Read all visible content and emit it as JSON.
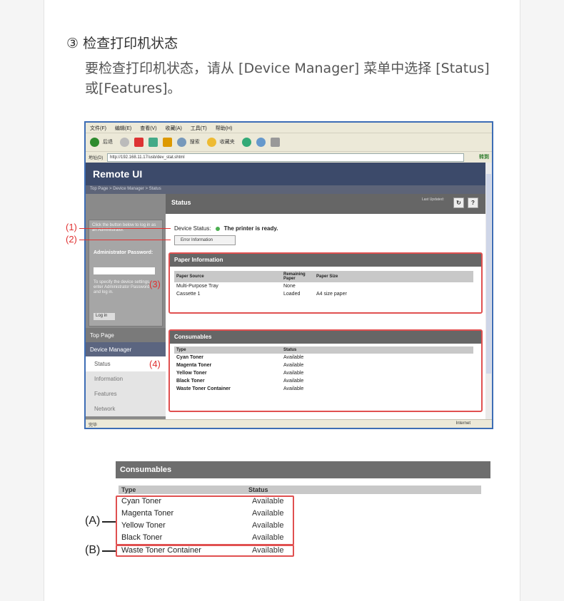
{
  "step": {
    "title": "③ 检查打印机状态",
    "description": "要检查打印机状态，请从 [Device Manager] 菜单中选择 [Status] 或[Features]。"
  },
  "browser": {
    "menu": [
      "文件(F)",
      "编辑(E)",
      "查看(V)",
      "收藏(A)",
      "工具(T)",
      "帮助(H)"
    ],
    "toolbar": {
      "back": "后退",
      "search": "搜索",
      "favorites": "收藏夹"
    },
    "address_label": "地址(D)",
    "address_url": "http://192.168.11.17/usb/dev_stat.shtml",
    "go_label": "转到",
    "app_title": "Remote UI",
    "breadcrumb": "Top Page > Device Manager > Status",
    "sidebar": {
      "hint": "Click the button below to log in as an Administrator.",
      "admin_label": "Administrator Password:",
      "note": "To specify the device settings, enter Administrator Password and log in.",
      "login_button": "Log in",
      "top_page": "Top Page",
      "device_manager": "Device Manager",
      "sub_items": [
        "Status",
        "Information",
        "Features",
        "Network"
      ]
    },
    "status": {
      "header": "Status",
      "last_updated": "Last Updated:",
      "refresh_icon": "↻",
      "help_icon": "?",
      "device_status_label": "Device Status:",
      "device_status_value": "The printer is ready.",
      "error_button": "Error Information"
    },
    "paper": {
      "header": "Paper Information",
      "columns": [
        "Paper Source",
        "Remaining Paper",
        "Paper Size"
      ],
      "rows": [
        [
          "Multi-Purpose Tray",
          "None",
          ""
        ],
        [
          "Cassette 1",
          "Loaded",
          "A4 size paper"
        ]
      ]
    },
    "consumables": {
      "header": "Consumables",
      "columns": [
        "Type",
        "Status"
      ],
      "rows": [
        [
          "Cyan Toner",
          "Available"
        ],
        [
          "Magenta Toner",
          "Available"
        ],
        [
          "Yellow Toner",
          "Available"
        ],
        [
          "Black Toner",
          "Available"
        ],
        [
          "Waste Toner Container",
          "Available"
        ]
      ]
    },
    "statusbar": {
      "left": "完毕",
      "right": "Internet"
    }
  },
  "callouts": [
    "(1)",
    "(2)",
    "(3)",
    "(4)"
  ],
  "enlarged": {
    "header": "Consumables",
    "col_type": "Type",
    "col_status": "Status",
    "rows": [
      [
        "Cyan Toner",
        "Available"
      ],
      [
        "Magenta Toner",
        "Available"
      ],
      [
        "Yellow Toner",
        "Available"
      ],
      [
        "Black Toner",
        "Available"
      ],
      [
        "Waste Toner Container",
        "Available"
      ]
    ],
    "label_a": "(A)",
    "label_b": "(B)"
  }
}
